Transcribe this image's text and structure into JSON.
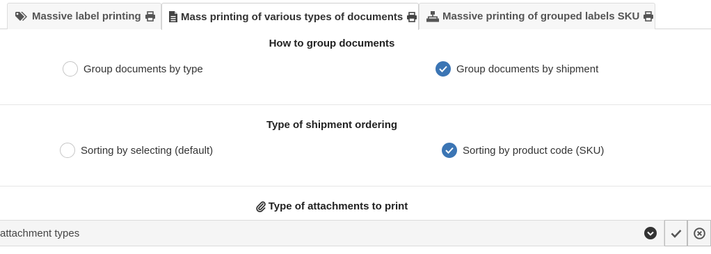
{
  "tabs": [
    {
      "label": "Massive label printing",
      "icon": "tags-icon",
      "print_icon": "printer-icon",
      "active": false
    },
    {
      "label": "Mass printing of various types of documents",
      "icon": "document-icon",
      "print_icon": "printer-icon",
      "active": true
    },
    {
      "label": "Massive printing of grouped labels SKU",
      "icon": "sitemap-icon",
      "print_icon": "printer-icon",
      "active": false
    }
  ],
  "group_section": {
    "title": "How to group documents",
    "options": [
      {
        "label": "Group documents by type",
        "checked": false
      },
      {
        "label": "Group documents by shipment",
        "checked": true
      }
    ]
  },
  "ordering_section": {
    "title": "Type of shipment ordering",
    "options": [
      {
        "label": "Sorting by selecting (default)",
        "checked": false
      },
      {
        "label": "Sorting by product code (SKU)",
        "checked": true
      }
    ]
  },
  "attachments_section": {
    "title": "Type of attachments to print",
    "title_icon": "paperclip-icon",
    "select_text": "attachment types",
    "caret_icon": "chevron-down-icon",
    "confirm_icon": "check-icon",
    "clear_icon": "clear-circle-icon"
  },
  "colors": {
    "accent": "#3b75b4",
    "border": "#dcdcdc",
    "bar": "#f5f5f5"
  }
}
